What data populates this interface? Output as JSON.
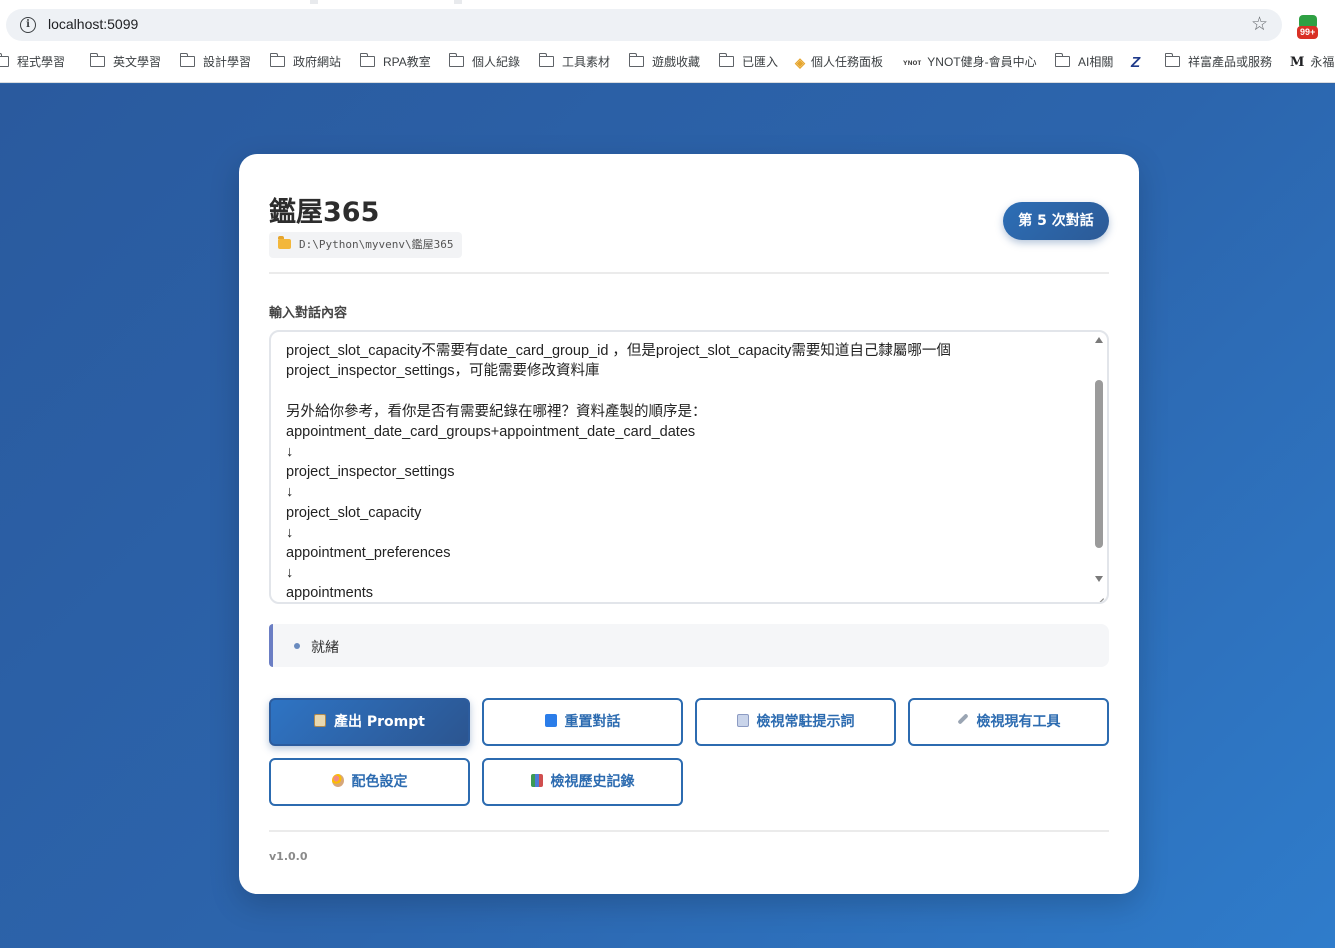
{
  "browser": {
    "url": "localhost:5099",
    "extension_badge": "99+",
    "bookmarks": [
      {
        "label": "程式學習",
        "icon": "folder-icon"
      },
      {
        "label": "英文學習",
        "icon": "folder-icon"
      },
      {
        "label": "設計學習",
        "icon": "folder-icon"
      },
      {
        "label": "政府網站",
        "icon": "folder-icon"
      },
      {
        "label": "RPA教室",
        "icon": "folder-icon"
      },
      {
        "label": "個人紀錄",
        "icon": "folder-icon"
      },
      {
        "label": "工具素材",
        "icon": "folder-icon"
      },
      {
        "label": "遊戲收藏",
        "icon": "folder-icon"
      },
      {
        "label": "已匯入",
        "icon": "folder-icon"
      },
      {
        "label": "個人任務面板",
        "icon": "colorful-app-icon"
      },
      {
        "label": "YNOT健身-會員中心",
        "icon": "ynot-icon"
      },
      {
        "label": "AI相關",
        "icon": "folder-icon"
      },
      {
        "label": "",
        "icon": "z-logo-icon"
      },
      {
        "label": "祥富產品或服務",
        "icon": "folder-icon"
      },
      {
        "label": "永福",
        "icon": "gmail-m-icon"
      }
    ]
  },
  "app": {
    "title": "鑑屋365",
    "path": "D:\\Python\\myvenv\\鑑屋365",
    "turn_badge": "第 5 次對話",
    "input_label": "輸入對話內容",
    "input_value": "project_slot_capacity不需要有date_card_group_id ，但是project_slot_capacity需要知道自己隸屬哪一個\nproject_inspector_settings，可能需要修改資料庫\n\n另外給你參考，看你是否有需要紀錄在哪裡？資料產製的順序是：\nappointment_date_card_groups+appointment_date_card_dates\n↓\nproject_inspector_settings\n↓\nproject_slot_capacity\n↓\nappointment_preferences\n↓\nappointments",
    "status_text": "就緒",
    "buttons": {
      "generate_prompt": "產出 Prompt",
      "reset_dialog": "重置對話",
      "view_system_prompt": "檢視常駐提示詞",
      "view_tools": "檢視現有工具",
      "color_settings": "配色設定",
      "view_history": "檢視歷史記錄"
    },
    "version": "v1.0.0"
  },
  "colors": {
    "accent": "#2c6bb0",
    "background": "#2e64a6",
    "status_border": "#6b7ec4"
  }
}
